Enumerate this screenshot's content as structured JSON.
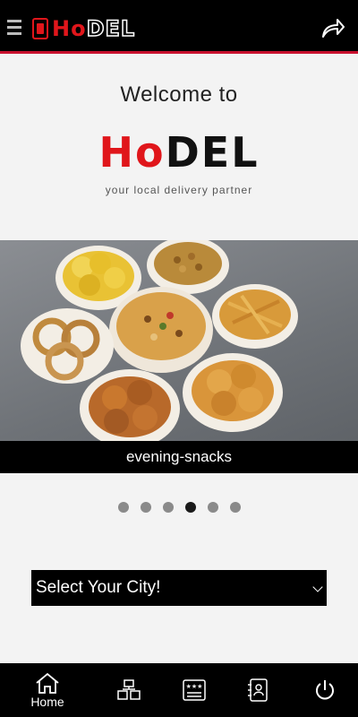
{
  "header": {
    "logo_ho": "Ho",
    "logo_del": "DEL"
  },
  "welcome": {
    "title": "Welcome to",
    "brand_ho": "Ho",
    "brand_del": "DEL",
    "tagline": "your local delivery partner"
  },
  "carousel": {
    "caption": "evening-snacks",
    "slide_count": 6,
    "active_slide": 4
  },
  "city_select": {
    "selected": "Select Your City!"
  },
  "bottom_nav": {
    "home_label": "Home"
  },
  "colors": {
    "brand_red": "#e0161b",
    "bar_black": "#000000"
  }
}
